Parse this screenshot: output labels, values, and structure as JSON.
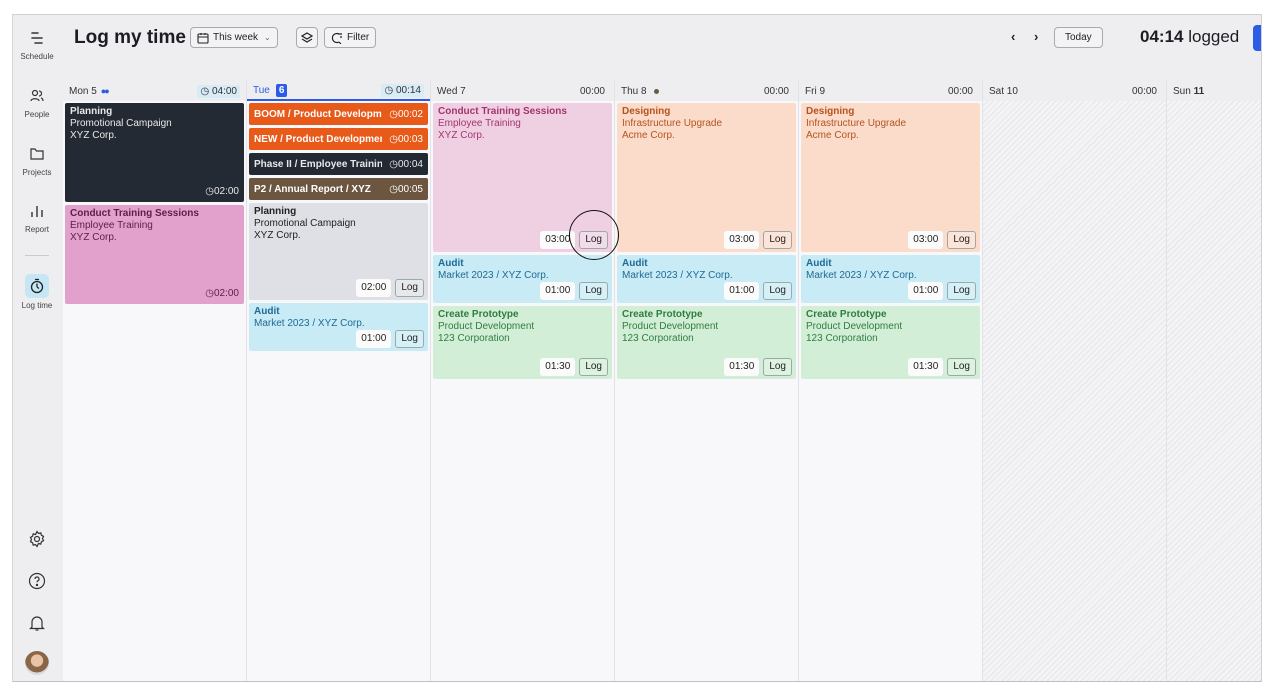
{
  "sidebar": {
    "items": [
      {
        "label": "Schedule",
        "icon": "schedule-icon"
      },
      {
        "label": "People",
        "icon": "people-icon"
      },
      {
        "label": "Projects",
        "icon": "folder-icon"
      },
      {
        "label": "Report",
        "icon": "bar-chart-icon"
      },
      {
        "label": "Log time",
        "icon": "stopwatch-icon",
        "active": true
      }
    ],
    "bottom": [
      {
        "icon": "gear-icon"
      },
      {
        "icon": "help-icon"
      },
      {
        "icon": "bell-icon"
      },
      {
        "icon": "avatar"
      }
    ]
  },
  "header": {
    "title": "Log my time",
    "range_label": "This week",
    "filter_label": "Filter",
    "today_label": "Today",
    "logged_value": "04:14",
    "logged_suffix": " logged"
  },
  "days": [
    {
      "name": "Mon 5",
      "total": "04:00"
    },
    {
      "name": "Tue",
      "num": "6",
      "total": "00:14"
    },
    {
      "name": "Wed 7",
      "total": "00:00"
    },
    {
      "name": "Thu 8",
      "total": "00:00"
    },
    {
      "name": "Fri 9",
      "total": "00:00"
    },
    {
      "name": "Sat 10",
      "total": "00:00"
    },
    {
      "name": "Sun",
      "num": "11"
    }
  ],
  "entries": {
    "mon": [
      {
        "title": "Planning",
        "project": "Promotional Campaign",
        "client": "XYZ Corp.",
        "time": "02:00"
      },
      {
        "title": "Conduct Training Sessions",
        "project": "Employee Training",
        "client": "XYZ Corp.",
        "time": "02:00"
      }
    ],
    "tue_running": [
      {
        "label": "BOOM / Product Development",
        "time": "00:02"
      },
      {
        "label": "NEW / Product Development",
        "time": "00:03"
      },
      {
        "label": "Phase II / Employee Training",
        "time": "00:04"
      },
      {
        "label": "P2 / Annual Report / XYZ",
        "time": "00:05"
      }
    ],
    "tue": [
      {
        "title": "Planning",
        "project": "Promotional Campaign",
        "client": "XYZ Corp.",
        "time": "02:00",
        "action": "Log"
      },
      {
        "title": "Audit",
        "project": "Market 2023 / XYZ Corp.",
        "time": "01:00",
        "action": "Log"
      }
    ],
    "wed": [
      {
        "title": "Conduct Training Sessions",
        "project": "Employee Training",
        "client": "XYZ Corp.",
        "time": "03:00",
        "action": "Log"
      },
      {
        "title": "Audit",
        "project": "Market 2023 / XYZ Corp.",
        "time": "01:00",
        "action": "Log"
      },
      {
        "title": "Create Prototype",
        "project": "Product Development",
        "client": "123 Corporation",
        "time": "01:30",
        "action": "Log"
      }
    ],
    "thu": [
      {
        "title": "Designing",
        "project": "Infrastructure Upgrade",
        "client": "Acme Corp.",
        "time": "03:00",
        "action": "Log"
      },
      {
        "title": "Audit",
        "project": "Market 2023 / XYZ Corp.",
        "time": "01:00",
        "action": "Log"
      },
      {
        "title": "Create Prototype",
        "project": "Product Development",
        "client": "123 Corporation",
        "time": "01:30",
        "action": "Log"
      }
    ],
    "fri": [
      {
        "title": "Designing",
        "project": "Infrastructure Upgrade",
        "client": "Acme Corp.",
        "time": "03:00",
        "action": "Log"
      },
      {
        "title": "Audit",
        "project": "Market 2023 / XYZ Corp.",
        "time": "01:00",
        "action": "Log"
      },
      {
        "title": "Create Prototype",
        "project": "Product Development",
        "client": "123 Corporation",
        "time": "01:30",
        "action": "Log"
      }
    ]
  },
  "colors": {
    "accent": "#2b5ce6",
    "running_orange": "#e85a1a",
    "running_dark": "#242a33",
    "running_brown": "#6c5640"
  }
}
